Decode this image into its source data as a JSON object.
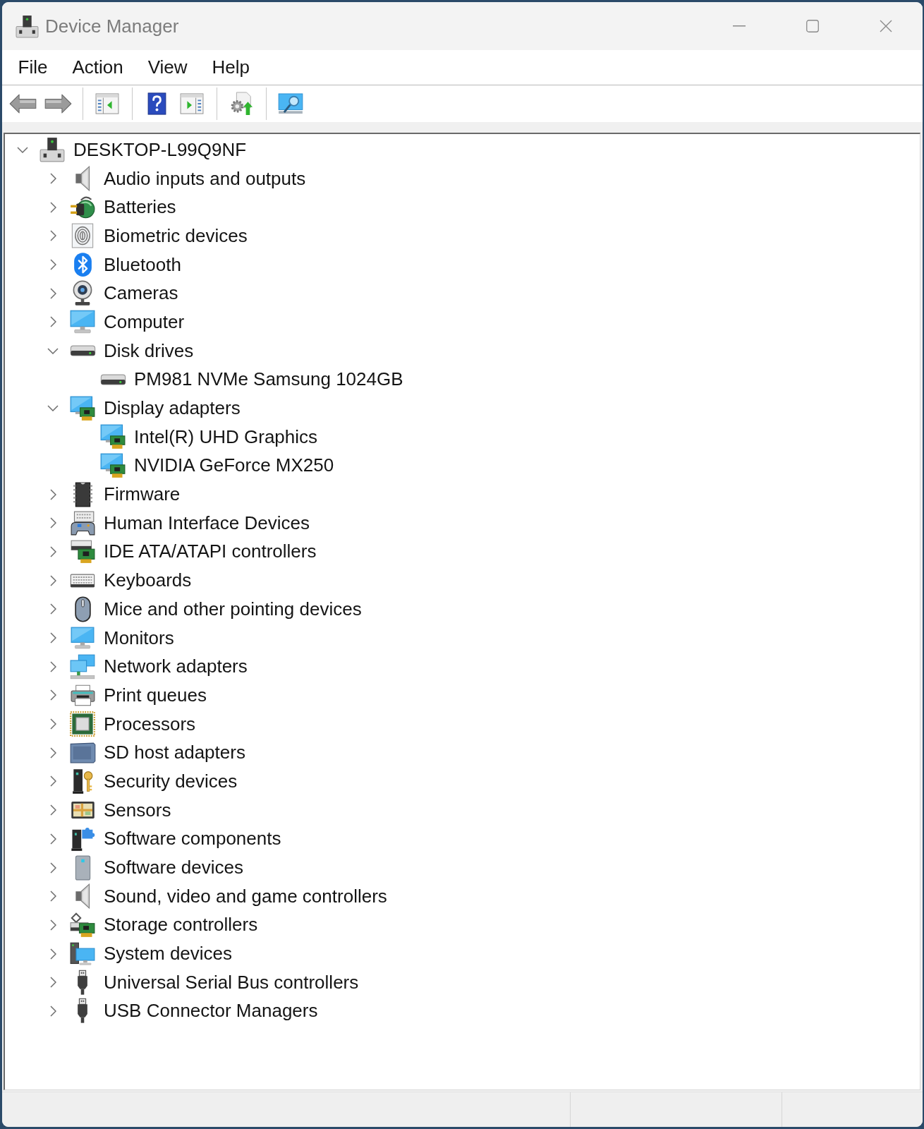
{
  "window": {
    "title": "Device Manager"
  },
  "menu": [
    "File",
    "Action",
    "View",
    "Help"
  ],
  "toolbar": [
    {
      "kind": "back"
    },
    {
      "kind": "forward"
    },
    {
      "kind": "separator"
    },
    {
      "kind": "tree"
    },
    {
      "kind": "separator"
    },
    {
      "kind": "help"
    },
    {
      "kind": "pane"
    },
    {
      "kind": "separator"
    },
    {
      "kind": "update"
    },
    {
      "kind": "separator"
    },
    {
      "kind": "scan"
    }
  ],
  "tree": {
    "label": "DESKTOP-L99Q9NF",
    "kind": "host",
    "expanded": true,
    "selected": false,
    "children": [
      {
        "label": "Audio inputs and outputs",
        "kind": "audio",
        "expanded": false,
        "selected": false
      },
      {
        "label": "Batteries",
        "kind": "battery",
        "expanded": false,
        "selected": false
      },
      {
        "label": "Biometric devices",
        "kind": "biometric",
        "expanded": false,
        "selected": false
      },
      {
        "label": "Bluetooth",
        "kind": "bluetooth",
        "expanded": false,
        "selected": false
      },
      {
        "label": "Cameras",
        "kind": "camera",
        "expanded": false,
        "selected": false
      },
      {
        "label": "Computer",
        "kind": "computer",
        "expanded": false,
        "selected": false
      },
      {
        "label": "Disk drives",
        "kind": "disk",
        "expanded": true,
        "selected": false,
        "children": [
          {
            "label": "PM981 NVMe Samsung 1024GB",
            "kind": "disk",
            "selected": false
          }
        ]
      },
      {
        "label": "Display adapters",
        "kind": "display",
        "expanded": true,
        "selected": false,
        "children": [
          {
            "label": "Intel(R) UHD Graphics",
            "kind": "display",
            "selected": false
          },
          {
            "label": "NVIDIA GeForce MX250",
            "kind": "display",
            "selected": false
          }
        ]
      },
      {
        "label": "Firmware",
        "kind": "firmware",
        "expanded": false,
        "selected": false
      },
      {
        "label": "Human Interface Devices",
        "kind": "hid",
        "expanded": false,
        "selected": false
      },
      {
        "label": "IDE ATA/ATAPI controllers",
        "kind": "ide",
        "expanded": false,
        "selected": false
      },
      {
        "label": "Keyboards",
        "kind": "keyboard",
        "expanded": false,
        "selected": false
      },
      {
        "label": "Mice and other pointing devices",
        "kind": "mouse",
        "expanded": false,
        "selected": false
      },
      {
        "label": "Monitors",
        "kind": "monitor",
        "expanded": false,
        "selected": false
      },
      {
        "label": "Network adapters",
        "kind": "network",
        "expanded": false,
        "selected": false
      },
      {
        "label": "Print queues",
        "kind": "printer",
        "expanded": false,
        "selected": false
      },
      {
        "label": "Processors",
        "kind": "processor",
        "expanded": false,
        "selected": false
      },
      {
        "label": "SD host adapters",
        "kind": "sdhost",
        "expanded": false,
        "selected": false
      },
      {
        "label": "Security devices",
        "kind": "security",
        "expanded": false,
        "selected": false
      },
      {
        "label": "Sensors",
        "kind": "sensor",
        "expanded": false,
        "selected": false
      },
      {
        "label": "Software components",
        "kind": "component",
        "expanded": false,
        "selected": false
      },
      {
        "label": "Software devices",
        "kind": "software",
        "expanded": false,
        "selected": false
      },
      {
        "label": "Sound, video and game controllers",
        "kind": "sound",
        "expanded": false,
        "selected": false
      },
      {
        "label": "Storage controllers",
        "kind": "storage",
        "expanded": false,
        "selected": false
      },
      {
        "label": "System devices",
        "kind": "system",
        "expanded": false,
        "selected": false
      },
      {
        "label": "Universal Serial Bus controllers",
        "kind": "usb",
        "expanded": false,
        "selected": false
      },
      {
        "label": "USB Connector Managers",
        "kind": "usb",
        "expanded": false,
        "selected": false
      }
    ]
  }
}
